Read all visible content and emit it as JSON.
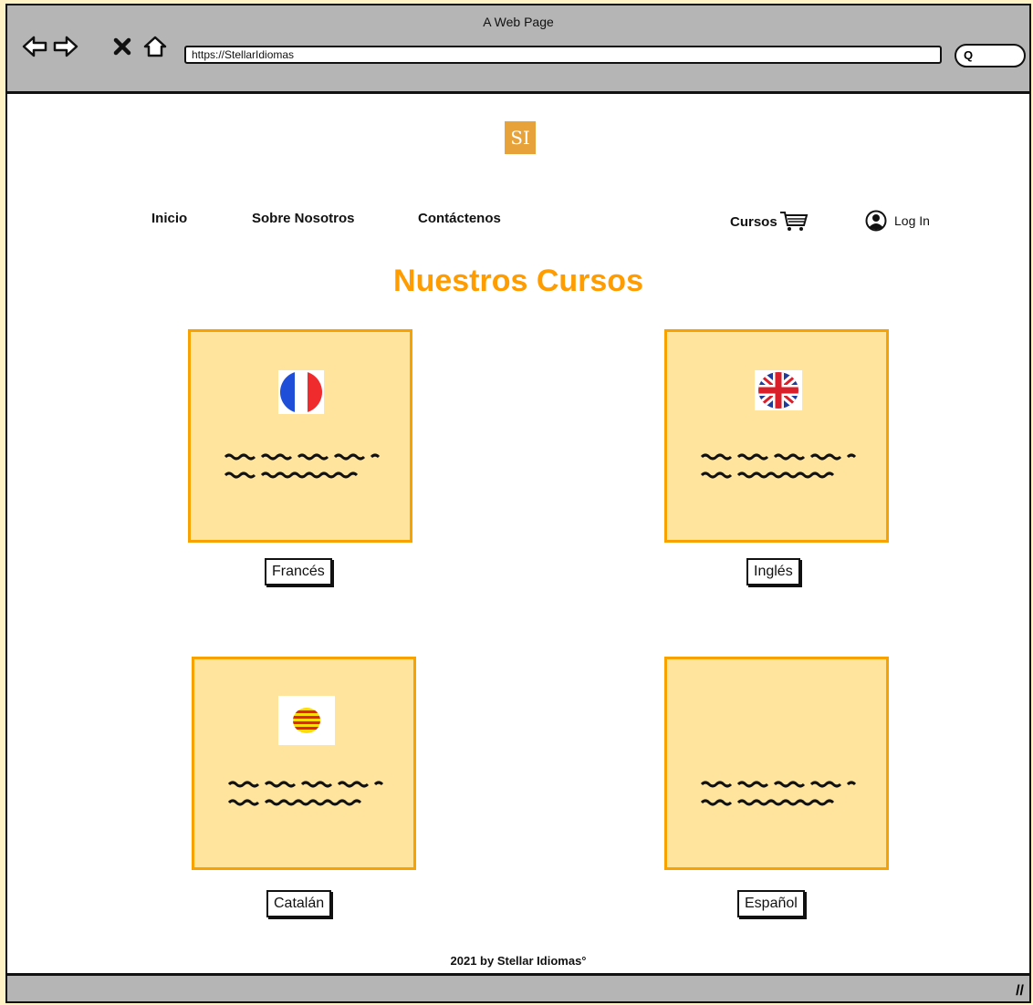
{
  "window": {
    "title": "A Web Page"
  },
  "browser": {
    "url": "https://StellarIdiomas"
  },
  "logo": {
    "text": "SI"
  },
  "nav": {
    "inicio": "Inicio",
    "sobre": "Sobre Nosotros",
    "contacto": "Contáctenos",
    "cursos": "Cursos",
    "login": "Log In"
  },
  "main": {
    "heading": "Nuestros Cursos",
    "courses": [
      {
        "label": "Francés",
        "flag": "france-flag"
      },
      {
        "label": "Inglés",
        "flag": "uk-flag"
      },
      {
        "label": "Catalán",
        "flag": "catalonia-flag"
      },
      {
        "label": "Español",
        "flag": ""
      }
    ]
  },
  "footer": {
    "text": "2021 by Stellar Idiomas°"
  },
  "colors": {
    "accent": "#ff9c00",
    "card_bg": "#ffe49e",
    "card_border": "#f7a200",
    "logo_bg": "#e8a23a",
    "chrome": "#b5b5b5"
  }
}
